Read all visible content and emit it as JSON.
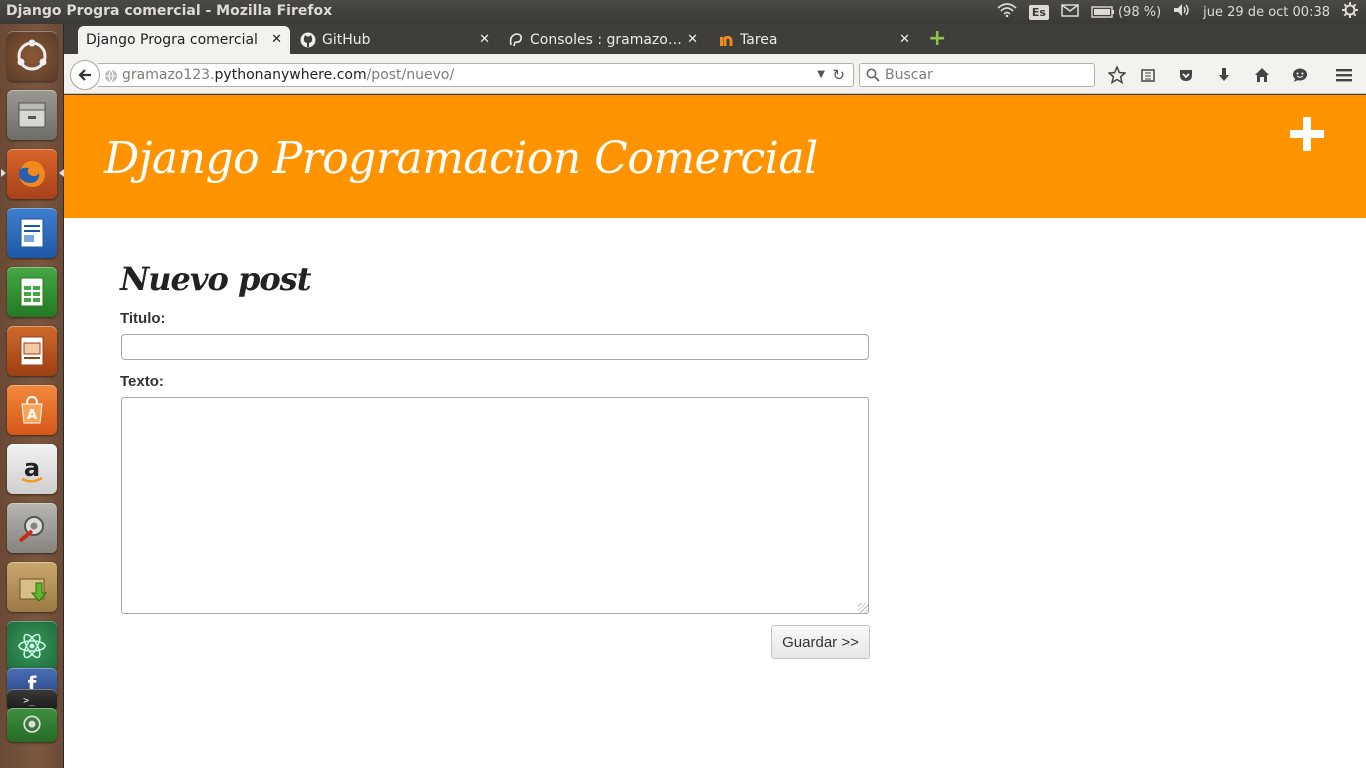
{
  "os": {
    "window_title": "Django Progra comercial - Mozilla Firefox",
    "keyboard_layout": "Es",
    "battery": "(98 %)",
    "datetime": "jue 29 de oct 00:38"
  },
  "launcher": {
    "items": [
      "dash-icon",
      "files-icon",
      "firefox-icon",
      "writer-icon",
      "calc-icon",
      "impress-icon",
      "software-center-icon",
      "amazon-icon",
      "system-settings-icon",
      "downloads-icon",
      "atom-icon",
      "facebook-icon",
      "terminal-icon",
      "workspace-icon"
    ]
  },
  "browser": {
    "tabs": [
      {
        "label": "Django Progra comercial",
        "active": true
      },
      {
        "label": "GitHub",
        "active": false
      },
      {
        "label": "Consoles : gramazo…",
        "active": false
      },
      {
        "label": "Tarea",
        "active": false
      }
    ],
    "url_host_prefix": "gramazo123.",
    "url_host_main": "pythonanywhere.com",
    "url_path": "/post/nuevo/",
    "search_placeholder": "Buscar"
  },
  "page": {
    "header_color": "#ff9400",
    "site_title": "Django Programacion Comercial",
    "form_title": "Nuevo post",
    "label_titulo": "Titulo:",
    "label_texto": "Texto:",
    "titulo_value": "",
    "texto_value": "",
    "save_label": "Guardar >>"
  }
}
